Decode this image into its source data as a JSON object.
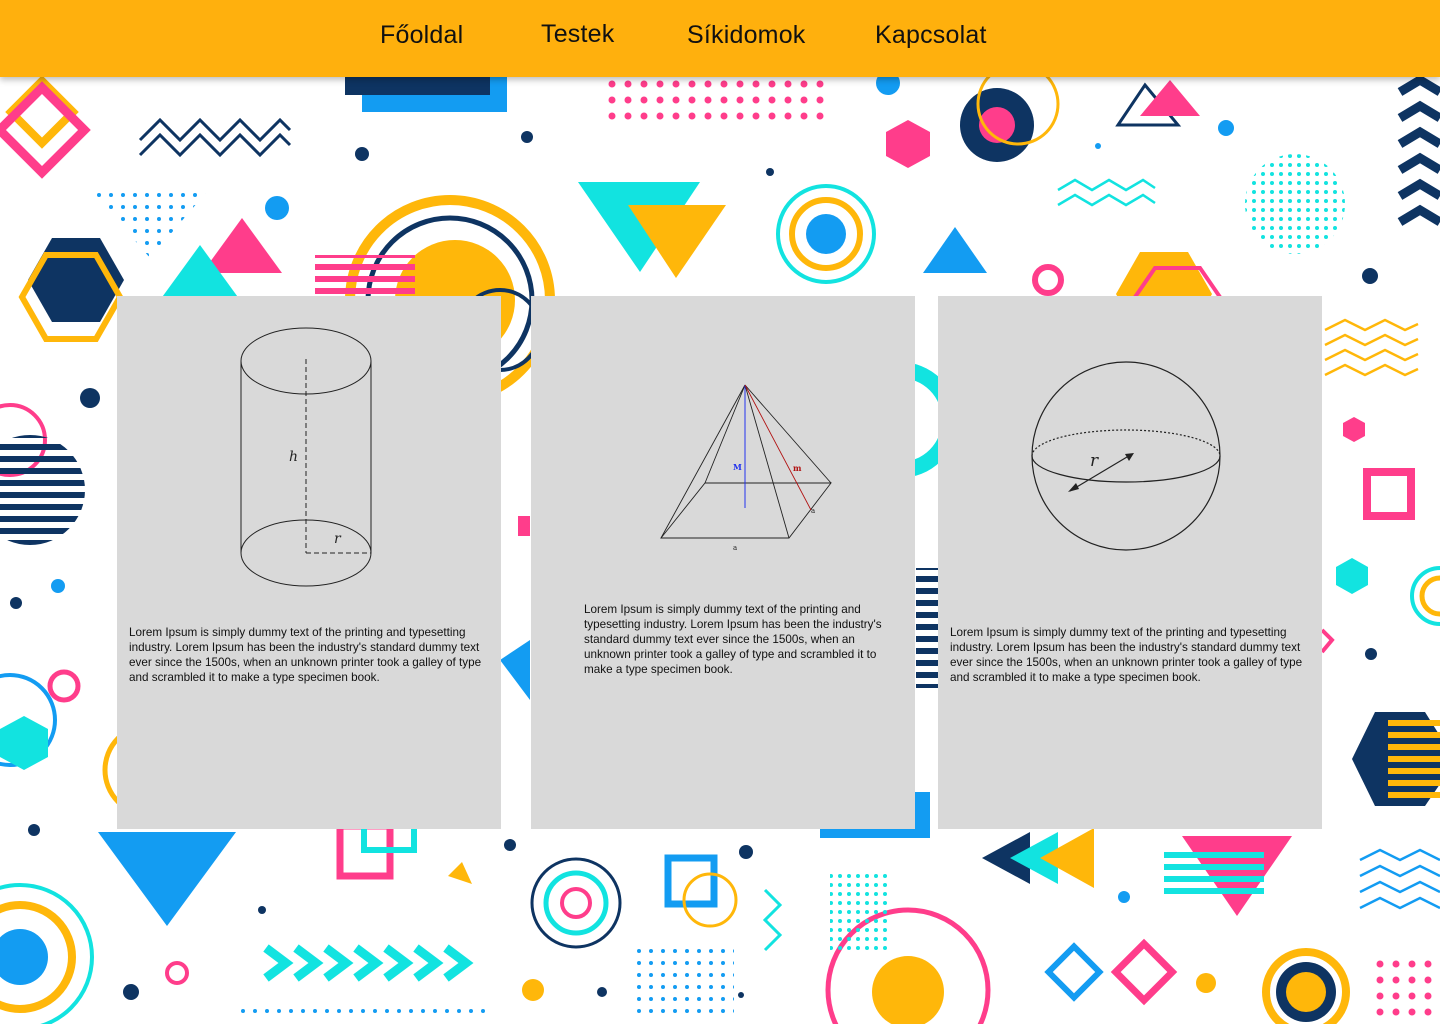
{
  "nav": {
    "items": [
      {
        "label": "Főoldal"
      },
      {
        "label": "Testek"
      },
      {
        "label": "Síkidomok"
      },
      {
        "label": "Kapcsolat"
      }
    ]
  },
  "cards": [
    {
      "figure": "cylinder-diagram",
      "labels": {
        "height": "h",
        "radius": "r"
      },
      "text": "Lorem Ipsum is simply dummy text of the printing and typesetting industry. Lorem Ipsum has been the industry's standard dummy text ever since the 1500s, when an unknown printer took a galley of type and scrambled it to make a type specimen book."
    },
    {
      "figure": "pyramid-diagram",
      "labels": {
        "height": "M",
        "slant": "m",
        "edge": "a",
        "base": "a"
      },
      "text": "Lorem Ipsum is simply dummy text of the printing and typesetting industry. Lorem Ipsum has been the industry's standard dummy text ever since the 1500s, when an unknown printer took a galley of type and scrambled it to make a type specimen book."
    },
    {
      "figure": "sphere-diagram",
      "labels": {
        "radius": "r"
      },
      "text": "Lorem Ipsum is simply dummy text of the printing and typesetting industry. Lorem Ipsum has been the industry's standard dummy text ever since the 1500s, when an unknown printer took a galley of type and scrambled it to make a type specimen book."
    }
  ],
  "colors": {
    "navbar": "#FFB00D",
    "card": "#D9D9D9",
    "pink": "#FF3D8B",
    "cyan": "#12E3E0",
    "navy": "#0E3462",
    "blue": "#139CF2",
    "yellow": "#FFB70A"
  }
}
